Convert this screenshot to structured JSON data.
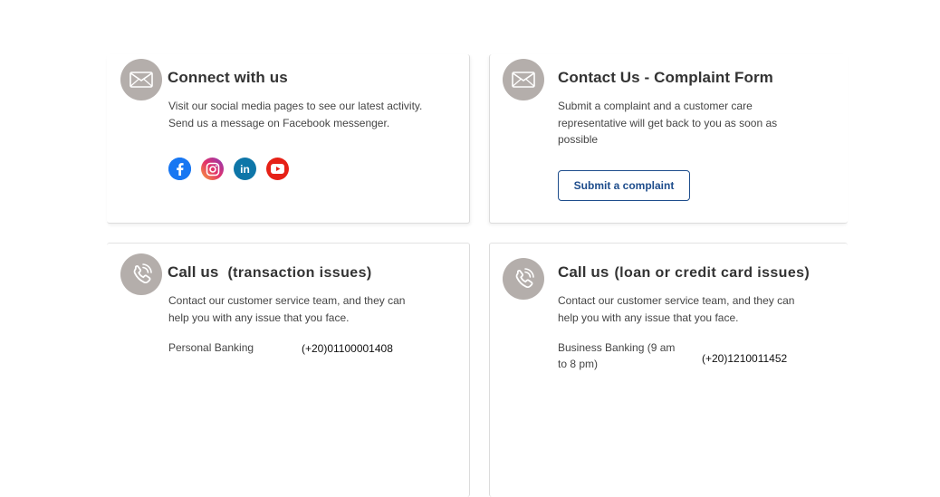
{
  "connect": {
    "title": "Connect with us",
    "desc_line1": "Visit our social media pages to see our latest activity.",
    "desc_line2": "Send us a message on Facebook messenger.",
    "social": [
      {
        "icon": "facebook-icon",
        "glyph": "f",
        "color": "#1877f2"
      },
      {
        "icon": "instagram-icon",
        "glyph": "◎",
        "color": "#d6249f"
      },
      {
        "icon": "linkedin-icon",
        "glyph": "in",
        "color": "#0a66c2"
      },
      {
        "icon": "youtube-icon",
        "glyph": "▶",
        "color": "#e62117"
      }
    ]
  },
  "complaint": {
    "title": "Contact Us - Complaint Form",
    "desc_line1": "Submit a complaint and a customer care",
    "desc_line2": "representative will get back to you as soon as",
    "desc_line3": "possible",
    "button_label": "Submit a complaint"
  },
  "call_transaction": {
    "title": "Call us",
    "subtitle": "(transaction issues)",
    "desc_line1": "Contact our customer service team, and they can",
    "desc_line2": "help you with any issue that you face.",
    "label": "Personal Banking",
    "phone": "(+20)01100001408"
  },
  "call_loan": {
    "title": "Call us",
    "subtitle": "(loan or credit card issues)",
    "desc_line1": "Contact our customer service team, and they can",
    "desc_line2": "help you with any issue that you face.",
    "label_line1": "Business Banking (9 am",
    "label_line2": "to 8 pm)",
    "phone": "(+20)1210011452"
  },
  "colors": {
    "icon_circle": "#b4aeab",
    "button_border": "#1e4d8c"
  }
}
